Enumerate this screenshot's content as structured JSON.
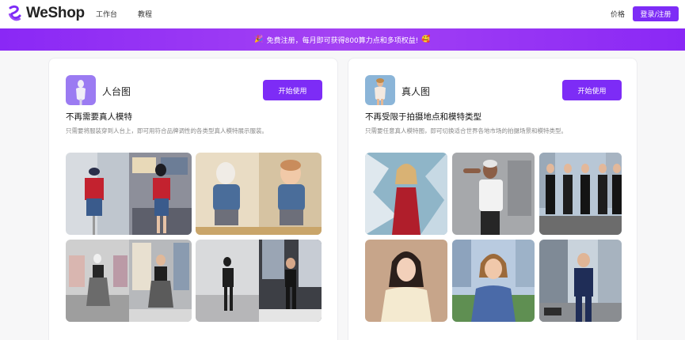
{
  "header": {
    "logo_text": "WeShop",
    "nav": [
      "工作台",
      "教程"
    ],
    "price_label": "价格",
    "login_label": "登录/注册"
  },
  "banner": {
    "text": "免费注册，每月即可获得800算力点和多项权益!",
    "lead_emoji": "🎉",
    "trail_emoji": "🥰"
  },
  "cards": [
    {
      "title": "人台图",
      "button": "开始使用",
      "subtitle": "不再需要真人模特",
      "description": "只需要将服装穿到人台上，即可用符合品牌调性的各类型真人模特展示服装。"
    },
    {
      "title": "真人图",
      "button": "开始使用",
      "subtitle": "不再受限于拍摄地点和模特类型",
      "description": "只需要任意真人模特图，即可切换适合世界各地市场的拍摄场景和模特类型。"
    }
  ],
  "colors": {
    "accent": "#7d2cf6",
    "banner_start": "#8a28f5",
    "banner_mid": "#a442f3"
  }
}
